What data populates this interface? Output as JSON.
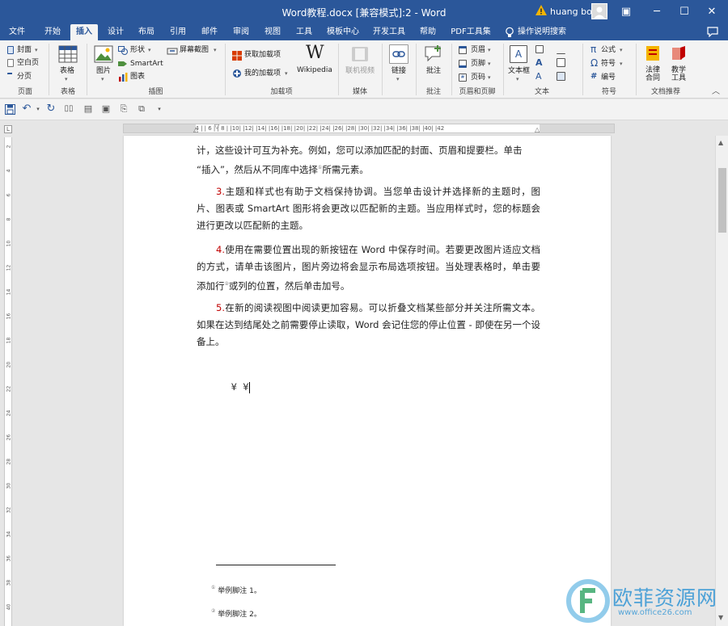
{
  "window": {
    "title": "Word教程.docx [兼容模式]:2  -  Word",
    "user": "huang bo",
    "controls": {
      "ribbon_options": "▣",
      "minimize": "─",
      "maximize": "☐",
      "close": "✕"
    }
  },
  "tabs": [
    "文件",
    "开始",
    "插入",
    "设计",
    "布局",
    "引用",
    "邮件",
    "审阅",
    "视图",
    "工具",
    "模板中心",
    "开发工具",
    "帮助",
    "PDF工具集"
  ],
  "search_label": "操作说明搜索",
  "ribbon": {
    "pages": {
      "cover": "封面",
      "blank_page": "空白页",
      "page_break": "分页",
      "label": "页面"
    },
    "tables": {
      "table": "表格",
      "label": "表格"
    },
    "illustrations": {
      "picture": "图片",
      "shapes": "形状",
      "smartart": "SmartArt",
      "chart": "图表",
      "screenshot": "屏幕截图",
      "label": "插图"
    },
    "addins": {
      "get": "获取加载项",
      "my": "我的加载项",
      "wikipedia": "Wikipedia",
      "label": "加载项"
    },
    "media": {
      "online_video": "联机视频",
      "label": "媒体"
    },
    "links": {
      "link": "链接"
    },
    "comments": {
      "comment": "批注",
      "label": "批注"
    },
    "header_footer": {
      "header": "页眉",
      "footer": "页脚",
      "page_number": "页码",
      "label": "页眉和页脚"
    },
    "text": {
      "textbox": "文本框",
      "label": "文本"
    },
    "symbols": {
      "equation": "公式",
      "symbol": "符号",
      "numbering": "编号",
      "label": "符号"
    },
    "recommend": {
      "legal": "法律\n合同",
      "teaching": "教学\n工具",
      "label": "文档推荐"
    }
  },
  "hruler": "| 8 |  | 6 |  | 4 |  | 2 |  |   | 2 |  | 4 |  | 6 |  | 8 |  |10|  |12|  |14|  |16|  |18|  |20|  |22|  |24|  |26|  |28|  |30|  |32|  |34|  |36|  |38|  |40|  |42",
  "vruler_ticks": [
    "2",
    "4",
    "6",
    "8",
    "10",
    "12",
    "14",
    "16",
    "18",
    "20",
    "22",
    "24",
    "26",
    "28",
    "30",
    "32",
    "34",
    "36",
    "38",
    "40"
  ],
  "document": {
    "p0": {
      "line1": "计，这些设计可互为补充。例如，您可以添加匹配的封面、页眉和提要栏。单击",
      "line2a": "“插入”，然后从不同库中选择",
      "fn": "①",
      "line2b": "所需元素。"
    },
    "p3": {
      "num": "3.",
      "text": "主题和样式也有助于文档保持协调。当您单击设计并选择新的主题时，图片、图表或 SmartArt 图形将会更改以匹配新的主题。当应用样式时，您的标题会进行更改以匹配新的主题。"
    },
    "p4": {
      "num": "4.",
      "text_a": "使用在需要位置出现的新按钮在 Word 中保存时间。若要更改图片适应文档的方式，请单击该图片，图片旁边将会显示布局选项按钮。当处理表格时，单击要添加行",
      "fn": "②",
      "text_b": "或列的位置，然后单击加号。"
    },
    "p5": {
      "num": "5.",
      "text": "在新的阅读视图中阅读更加容易。可以折叠文档某些部分并关注所需文本。如果在达到结尾处之前需要停止读取，Word 会记住您的停止位置 - 即使在另一个设备上。"
    },
    "symbols": "¥  ¥",
    "footnotes": [
      {
        "mark": "①",
        "text": "举例脚注 1。"
      },
      {
        "mark": "②",
        "text": "举例脚注 2。"
      }
    ]
  },
  "watermark": {
    "text_cn": "欧菲资源网",
    "text_url": "www.office26.com"
  },
  "colors": {
    "brand": "#2b579a",
    "accent_red": "#c00000"
  }
}
